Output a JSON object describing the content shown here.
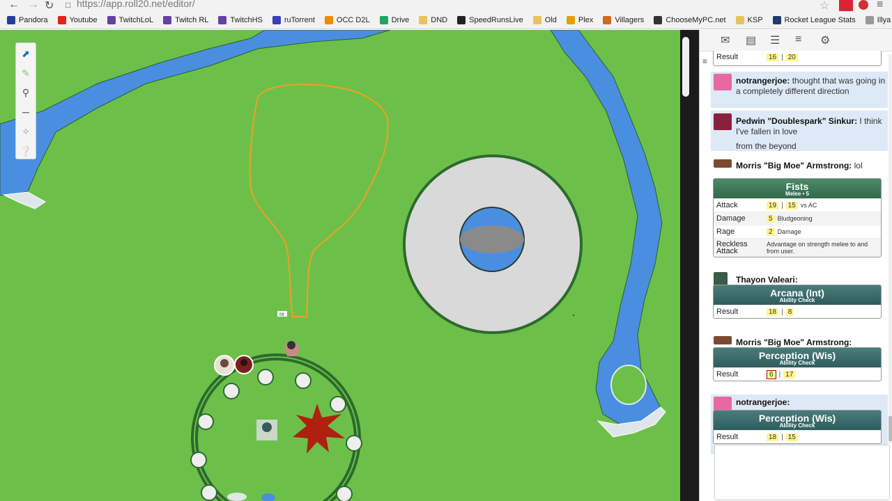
{
  "browser": {
    "url": "https://app.roll20.net/editor/",
    "bookmarks": [
      {
        "label": "Pandora",
        "icon": "pandora-icon",
        "color": "#224099"
      },
      {
        "label": "Youtube",
        "icon": "youtube-icon",
        "color": "#e62117"
      },
      {
        "label": "TwitchLoL",
        "icon": "twitch-icon",
        "color": "#6441a5"
      },
      {
        "label": "Twitch RL",
        "icon": "twitch-icon",
        "color": "#6441a5"
      },
      {
        "label": "TwitchHS",
        "icon": "twitch-icon",
        "color": "#6441a5"
      },
      {
        "label": "ruTorrent",
        "icon": "torrent-icon",
        "color": "#3c3cbe"
      },
      {
        "label": "OCC D2L",
        "icon": "d2l-icon",
        "color": "#f08a00"
      },
      {
        "label": "Drive",
        "icon": "drive-icon",
        "color": "#1fa463"
      },
      {
        "label": "DND",
        "icon": "folder-icon",
        "color": "#e8c25c"
      },
      {
        "label": "SpeedRunsLive",
        "icon": "srl-icon",
        "color": "#222222"
      },
      {
        "label": "Old",
        "icon": "folder-icon",
        "color": "#e8c25c"
      },
      {
        "label": "Plex",
        "icon": "plex-icon",
        "color": "#e5a00d"
      },
      {
        "label": "Villagers",
        "icon": "villagers-icon",
        "color": "#d2691e"
      },
      {
        "label": "ChooseMyPC.net",
        "icon": "monitor-icon",
        "color": "#333333"
      },
      {
        "label": "KSP",
        "icon": "folder-icon",
        "color": "#e8c25c"
      },
      {
        "label": "Rocket League Stats",
        "icon": "rocket-icon",
        "color": "#1f3b6e"
      },
      {
        "label": "Illya Dance",
        "icon": "page-icon",
        "color": "#999999"
      }
    ]
  },
  "map": {
    "colors": {
      "grass": "#6cc04a",
      "river": "#4a8ee0",
      "token_ring": "#2d6a2d",
      "drawing": "#f0a020",
      "circle_fill": "#d9d9d9"
    },
    "label_small": "0ft"
  },
  "panel": {
    "tabs": [
      "chat-icon",
      "journal-icon",
      "compendium-icon",
      "list-icon",
      "settings-icon"
    ],
    "partial_roll": {
      "label": "Result",
      "v1": "16",
      "v2": "20"
    },
    "messages": [
      {
        "who": "notrangerjoe:",
        "text": "thought that was going in a completely different direction"
      },
      {
        "who": "Pedwin \"Doublespark\" Sinkur:",
        "text": "I think I've fallen in love",
        "text2": "from the beyond"
      },
      {
        "who": "Morris \"Big Moe\" Armstrong:",
        "text": "lol"
      }
    ],
    "fists": {
      "title": "Fists",
      "subtitle": "Melee • 5",
      "attack_label": "Attack",
      "attack1": "19",
      "attack2": "15",
      "vs": "vs AC",
      "damage_label": "Damage",
      "damage_val": "5",
      "damage_type": "Bludgeoning",
      "rage_label": "Rage",
      "rage_val": "2",
      "rage_type": "Damage",
      "reckless_label1": "Reckless",
      "reckless_label2": "Attack",
      "reckless_text": "Advantage on strength melee to and from user."
    },
    "thayon": {
      "who": "Thayon Valeari:",
      "title": "Arcana (Int)",
      "subtitle": "Ability Check",
      "label": "Result",
      "v1": "18",
      "v2": "8"
    },
    "morris2": {
      "who": "Morris \"Big Moe\" Armstrong:",
      "title": "Perception (Wis)",
      "subtitle": "Ability Check",
      "label": "Result",
      "v1": "6",
      "v2": "17"
    },
    "joe2": {
      "who": "notrangerjoe:",
      "title": "Perception (Wis)",
      "subtitle": "Ability Check",
      "label": "Result",
      "v1": "18",
      "v2": "15"
    }
  }
}
